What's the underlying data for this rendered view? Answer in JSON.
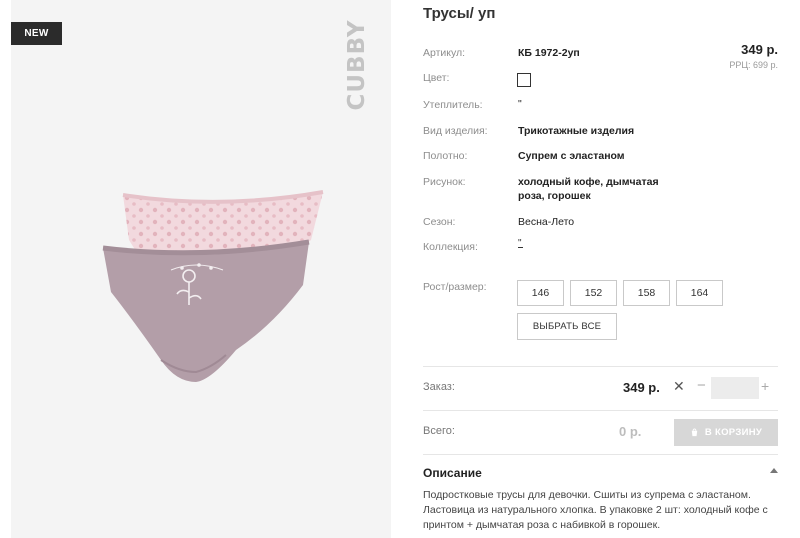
{
  "image_panel": {
    "badge": "NEW",
    "brand": "CUBBY"
  },
  "product": {
    "title": "Трусы/ уп",
    "price": "349 р.",
    "rrp": "РРЦ: 699 р.",
    "attributes": {
      "article": {
        "label": "Артикул:",
        "value": "КБ 1972-2уп"
      },
      "color": {
        "label": "Цвет:"
      },
      "insulation": {
        "label": "Утеплитель:",
        "value": "\""
      },
      "item_type": {
        "label": "Вид изделия:",
        "value": "Трикотажные изделия"
      },
      "fabric": {
        "label": "Полотно:",
        "value": "Супрем с эластаном"
      },
      "pattern": {
        "label": "Рисунок:",
        "value": "холодный кофе, дымчатая роза, горошек"
      },
      "season": {
        "label": "Сезон:",
        "value": "Весна-Лето"
      },
      "collection": {
        "label": "Коллекция:",
        "value": "\""
      }
    },
    "sizes_label": "Рост/размер:",
    "sizes": [
      "146",
      "152",
      "158",
      "164"
    ],
    "select_all": "ВЫБРАТЬ ВСЕ"
  },
  "order": {
    "label": "Заказ:",
    "price": "349 р.",
    "times": "✕",
    "minus": "−",
    "quantity": "",
    "plus": "+"
  },
  "total": {
    "label": "Всего:",
    "value": "0 р.",
    "cart_button": "В КОРЗИНУ"
  },
  "description": {
    "title": "Описание",
    "text": "Подростковые трусы для девочки. Сшиты из супрема с эластаном. Ластовица из натурального хлопка. В упаковке 2 шт: холодный кофе с принтом + дымчатая роза с набивкой в горошек."
  },
  "colors": {
    "badge_bg": "#2b2b2b",
    "image_bg": "#f4f4f4",
    "brief_pink": "#f0d5da",
    "brief_mauve": "#b09aa4",
    "cart_button_bg": "#d7d7d7"
  }
}
